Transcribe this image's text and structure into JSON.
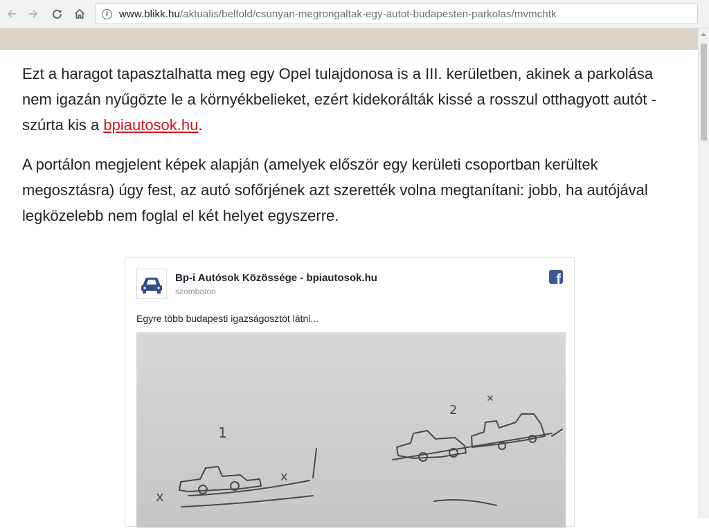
{
  "browser": {
    "back_icon": "arrow-left-icon",
    "forward_icon": "arrow-right-icon",
    "reload_icon": "reload-icon",
    "home_icon": "home-icon",
    "info_icon": "info-icon",
    "url_host": "www.blikk.hu",
    "url_path": "/aktualis/belfold/csunyan-megrongaltak-egy-autot-budapesten-parkolas/mvmchtk"
  },
  "article": {
    "p1_before_link": "Ezt a haragot tapasztalhatta meg egy Opel tulajdonosa is a III. kerületben, akinek a parkolása nem igazán nyűgözte le a környékbelieket, ezért kidekorálták kissé a rosszul otthagyott autót - szúrta kis a ",
    "p1_link": "bpiautosok.hu",
    "p1_after_link": ".",
    "p2": "A portálon megjelent képek alapján (amelyek először egy kerületi csoportban kerültek megosztásra) úgy fest, az autó sofőrjének azt szerették volna megtanítani: jobb, ha autójával legközelebb nem foglal el két helyet egyszerre.",
    "link_color": "#d6131d"
  },
  "embed": {
    "page_name": "Bp-i Autósok Közössége - bpiautosok.hu",
    "time": "szombaton",
    "post_text": "Egyre több budapesti igazságosztót látni...",
    "avatar_icon": "car-icon",
    "logo_icon": "facebook-icon",
    "brand_color": "#3b5998",
    "sketch_labels": {
      "left_number": "1",
      "right_number": "2",
      "left_mark": "x",
      "right_mark": "x"
    }
  }
}
